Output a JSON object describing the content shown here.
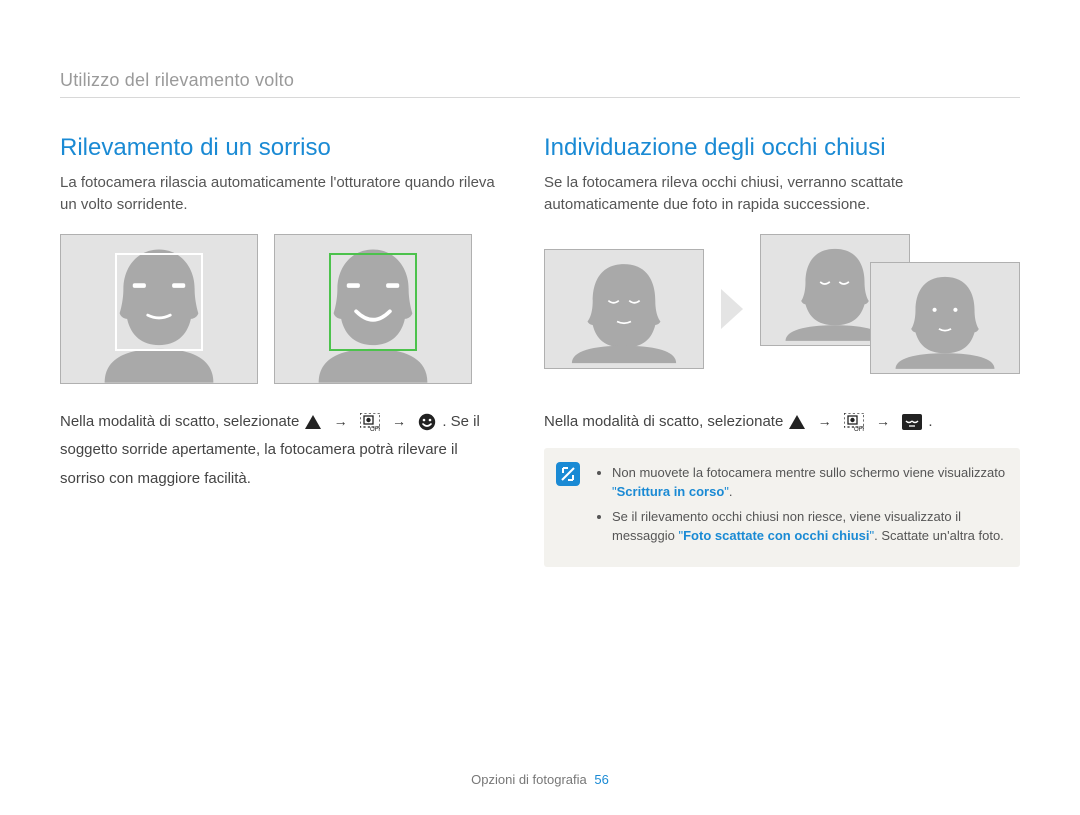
{
  "breadcrumb": "Utilizzo del rilevamento volto",
  "left": {
    "title": "Rilevamento di un sorriso",
    "intro": "La fotocamera rilascia automaticamente l'otturatore quando rileva un volto sorridente.",
    "instr_prefix": "Nella modalità di scatto, selezionate",
    "instr_suffix": ". Se il soggetto sorride apertamente, la fotocamera potrà rilevare il sorriso con maggiore facilità."
  },
  "right": {
    "title": "Individuazione degli occhi chiusi",
    "intro": "Se la fotocamera rileva occhi chiusi, verranno scattate automaticamente due foto in rapida successione.",
    "instr_prefix": "Nella modalità di scatto, selezionate",
    "instr_suffix": ".",
    "note_item1_pre": "Non muovete la fotocamera mentre sullo schermo viene visualizzato ",
    "note_item1_quote": "Scrittura in corso",
    "note_item1_post": ".",
    "note_item2_pre": "Se il rilevamento occhi chiusi non riesce, viene visualizzato il messaggio ",
    "note_item2_quote": "Foto scattate con occhi chiusi",
    "note_item2_post": ". Scattate un'altra foto."
  },
  "icons": {
    "up": "up-triangle-icon",
    "off": "face-off-icon",
    "smile": "smile-face-icon",
    "blink": "blink-icon",
    "arrow": "→"
  },
  "footer": {
    "label": "Opzioni di fotografia",
    "page": "56"
  }
}
